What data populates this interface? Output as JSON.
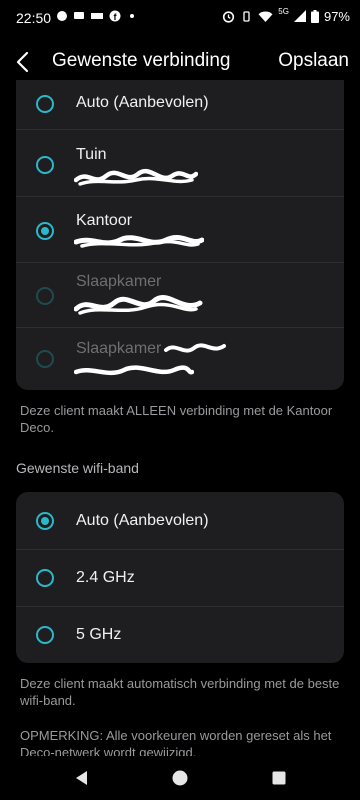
{
  "status_bar": {
    "time": "22:50",
    "battery": "97%",
    "network": "5G"
  },
  "header": {
    "title": "Gewenste verbinding",
    "save_label": "Opslaan"
  },
  "nodes": [
    {
      "label": "Auto (Aanbevolen)",
      "selected": false,
      "enabled": true
    },
    {
      "label": "Tuin",
      "selected": false,
      "enabled": true
    },
    {
      "label": "Kantoor",
      "selected": true,
      "enabled": true
    },
    {
      "label": "Slaapkamer",
      "selected": false,
      "enabled": false
    },
    {
      "label": "Slaapkamer",
      "selected": false,
      "enabled": false
    }
  ],
  "node_note": "Deze client maakt ALLEEN verbinding met de Kantoor Deco.",
  "band_section_title": "Gewenste wifi-band",
  "bands": [
    {
      "label": "Auto (Aanbevolen)",
      "selected": true
    },
    {
      "label": "2.4 GHz",
      "selected": false
    },
    {
      "label": "5 GHz",
      "selected": false
    }
  ],
  "band_note": "Deze client maakt automatisch verbinding met de beste wifi-band.",
  "remark": "OPMERKING: Alle voorkeuren worden gereset als het Deco-netwerk wordt gewijzigd.",
  "colors": {
    "accent": "#2bb8c8",
    "background": "#000000",
    "card": "#1e1e21"
  }
}
